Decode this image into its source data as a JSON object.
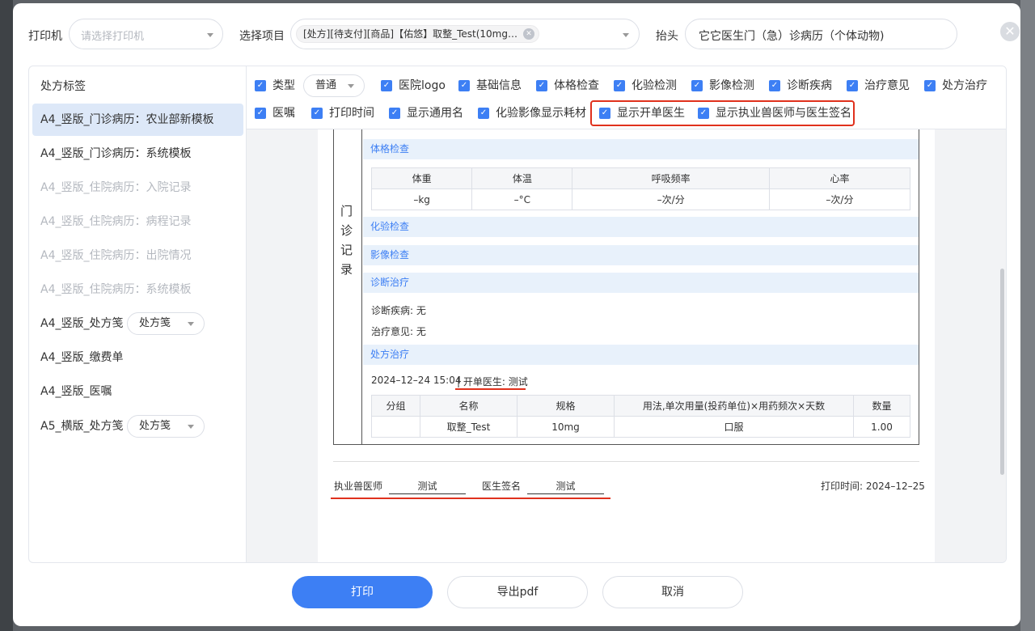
{
  "header": {
    "printer_label": "打印机",
    "printer_placeholder": "请选择打印机",
    "project_label": "选择项目",
    "project_tag": "[处方][待支付][商品]【佑悠】取整_Test(10mg…",
    "heading_label": "抬头",
    "heading_value": "它它医生门（急）诊病历（个体动物)"
  },
  "sidebar": {
    "title": "处方标签",
    "items": [
      {
        "label": "A4_竖版_门诊病历：农业部新模板"
      },
      {
        "label": "A4_竖版_门诊病历：系统模板"
      },
      {
        "label": "A4_竖版_住院病历：入院记录"
      },
      {
        "label": "A4_竖版_住院病历：病程记录"
      },
      {
        "label": "A4_竖版_住院病历：出院情况"
      },
      {
        "label": "A4_竖版_住院病历：系统模板"
      },
      {
        "label": "A4_竖版_处方笺",
        "select": "处方笺"
      },
      {
        "label": "A4_竖版_缴费单"
      },
      {
        "label": "A4_竖版_医嘱"
      },
      {
        "label": "A5_横版_处方笺",
        "select": "处方笺"
      }
    ]
  },
  "options": {
    "type_label": "类型",
    "type_value": "普通",
    "row1": [
      "医院logo",
      "基础信息",
      "体格检查",
      "化验检测",
      "影像检测",
      "诊断疾病",
      "治疗意见",
      "处方治疗"
    ],
    "row2": [
      "医嘱",
      "打印时间",
      "显示通用名",
      "化验影像显示耗材",
      "显示开单医生",
      "显示执业兽医师与医生签名"
    ]
  },
  "preview": {
    "vertical_label": [
      "门",
      "诊",
      "记",
      "录"
    ],
    "sections": {
      "physical": "体格检查",
      "lab": "化验检查",
      "imaging": "影像检查",
      "diagnosis": "诊断治疗",
      "rx": "处方治疗"
    },
    "vitals_headers": [
      "体重",
      "体温",
      "呼吸频率",
      "心率"
    ],
    "vitals_values": [
      "–kg",
      "–°C",
      "–次/分",
      "–次/分"
    ],
    "diagnosis_line": "诊断疾病: 无",
    "treatment_line": "治疗意见: 无",
    "rx_datetime": "2024–12–24 15:04",
    "rx_doctor": "| 开单医生: 测试",
    "rx_headers": [
      "分组",
      "名称",
      "规格",
      "用法,单次用量(投药单位)×用药频次×天数",
      "数量"
    ],
    "rx_row": [
      "",
      "取整_Test",
      "10mg",
      "口服",
      "1.00"
    ],
    "vet_label": "执业兽医师",
    "vet_value": "测试",
    "sign_label": "医生签名",
    "sign_value": "测试",
    "print_time": "打印时间: 2024–12–25"
  },
  "footer": {
    "print": "打印",
    "export": "导出pdf",
    "cancel": "取消"
  },
  "colors": {
    "accent": "#3d7ff4",
    "highlight": "#e0311d"
  }
}
